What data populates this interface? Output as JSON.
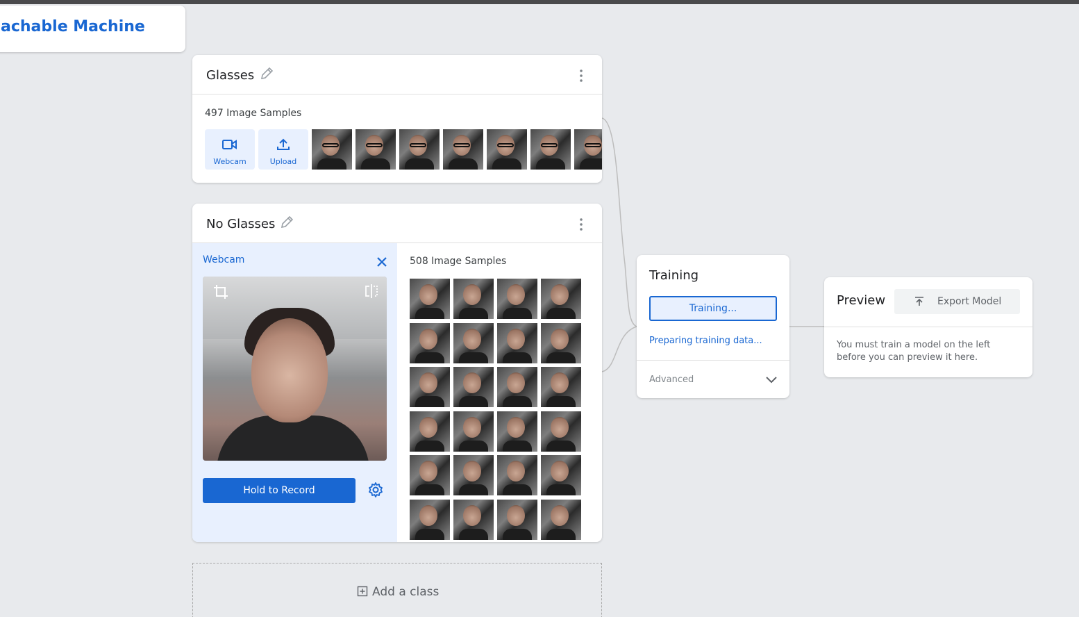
{
  "app": {
    "title": "Teachable Machine"
  },
  "classes": [
    {
      "name": "Glasses",
      "samples_label": "497 Image Samples",
      "sources": [
        {
          "label": "Webcam",
          "icon": "video-camera-icon"
        },
        {
          "label": "Upload",
          "icon": "upload-icon"
        }
      ],
      "thumb_count": 7
    },
    {
      "name": "No Glasses",
      "samples_label": "508 Image Samples",
      "webcam": {
        "label": "Webcam",
        "record_label": "Hold to Record"
      },
      "thumb_count": 24
    }
  ],
  "add_class": {
    "label": "Add a class"
  },
  "training": {
    "title": "Training",
    "button_label": "Training...",
    "status": "Preparing training data...",
    "advanced_label": "Advanced"
  },
  "preview": {
    "title": "Preview",
    "export_label": "Export Model",
    "message": "You must train a model on the left before you can preview it here."
  },
  "colors": {
    "accent": "#1967d2",
    "accent_light": "#e8f0fe",
    "canvas": "#e8eaed"
  }
}
